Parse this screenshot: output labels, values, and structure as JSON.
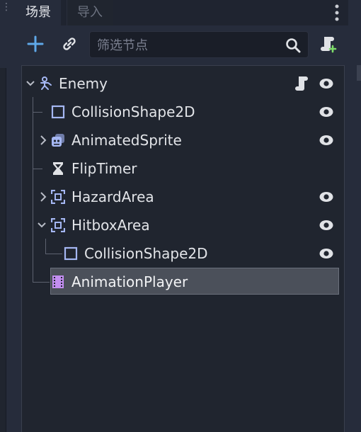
{
  "tabs": [
    {
      "label": "场景",
      "active": true
    },
    {
      "label": "导入",
      "active": false
    }
  ],
  "toolbar": {
    "filter_placeholder": "筛选节点",
    "filter_value": ""
  },
  "colors": {
    "node2d": "#a5b7f3",
    "area": "#a5b7f3",
    "animation": "#c38ef1",
    "accent": "#5fa8e8",
    "icon_light": "#e0e2e6"
  },
  "tree": {
    "nodes": [
      {
        "name": "Enemy",
        "icon": "kinematic-body-icon",
        "expanded": true,
        "has_script": true,
        "visible_toggle": true
      },
      {
        "name": "CollisionShape2D",
        "icon": "collision-shape-icon",
        "visible_toggle": true
      },
      {
        "name": "AnimatedSprite",
        "icon": "animated-sprite-icon",
        "collapsed": true,
        "visible_toggle": true
      },
      {
        "name": "FlipTimer",
        "icon": "timer-icon",
        "visible_toggle": false
      },
      {
        "name": "HazardArea",
        "icon": "area-icon",
        "collapsed": true,
        "visible_toggle": true
      },
      {
        "name": "HitboxArea",
        "icon": "area-icon",
        "expanded": true,
        "visible_toggle": true
      },
      {
        "name": "CollisionShape2D",
        "icon": "collision-shape-icon",
        "visible_toggle": true
      },
      {
        "name": "AnimationPlayer",
        "icon": "animation-player-icon",
        "selected": true,
        "visible_toggle": false
      }
    ]
  }
}
